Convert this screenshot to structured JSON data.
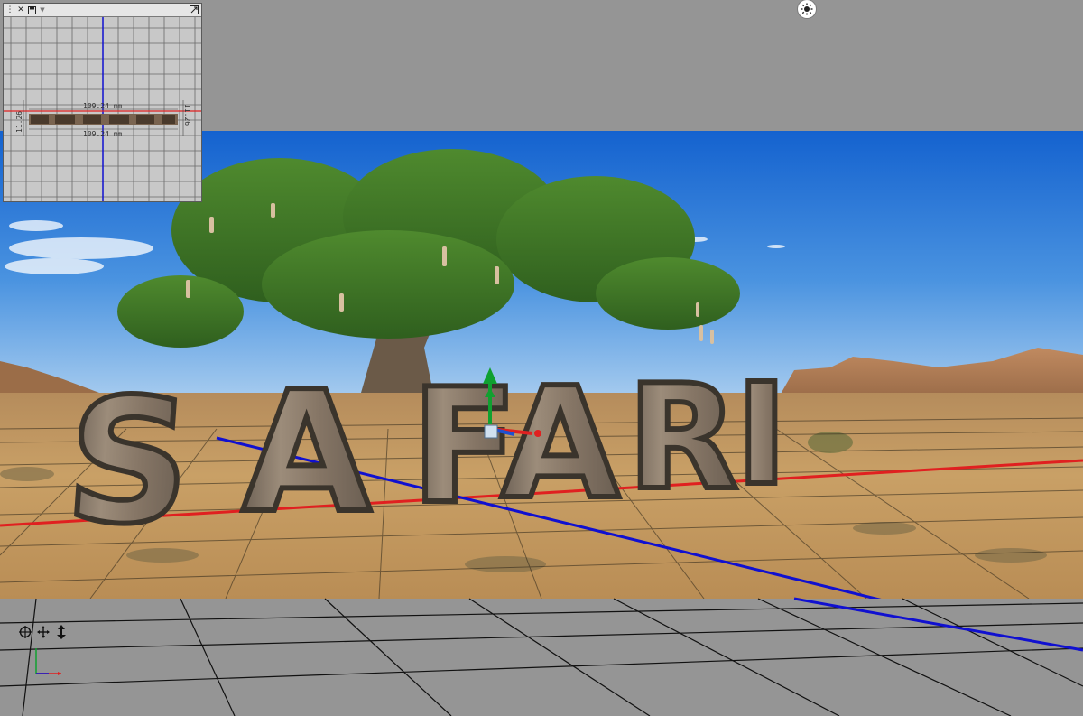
{
  "scene": {
    "title_word": "SAFARI",
    "letters": [
      "S",
      "A",
      "F",
      "A",
      "R",
      "I"
    ]
  },
  "navigator": {
    "dimension_top": "109.24 mm",
    "dimension_bottom": "109.24 mm",
    "dimension_left": "11.26",
    "dimension_right": "11.26"
  },
  "toolbar": {
    "icons": [
      "orbit-icon",
      "pan-icon",
      "dolly-icon"
    ]
  },
  "colors": {
    "sky_top": "#1d6fd6",
    "sky_bottom": "#9cc6ee",
    "ground": "#c9a066",
    "wood": "#8a7a68",
    "x_axis": "#e02020",
    "z_axis": "#1010d0",
    "y_axis": "#10a030",
    "ui_gray": "#959595"
  }
}
